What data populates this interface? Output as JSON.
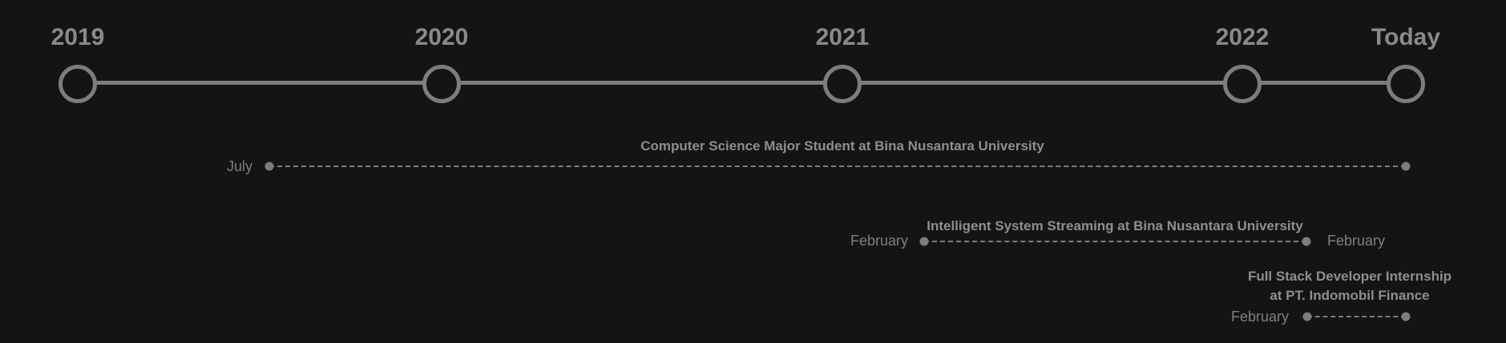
{
  "years": [
    "2019",
    "2020",
    "2021",
    "2022",
    "Today"
  ],
  "events": [
    {
      "title": "Computer Science Major Student at Bina Nusantara University",
      "start_label": "July",
      "end_label": ""
    },
    {
      "title": "Intelligent System Streaming at Bina Nusantara University",
      "start_label": "February",
      "end_label": "February"
    },
    {
      "title_line1": "Full Stack Developer Internship",
      "title_line2": "at PT. Indomobil Finance",
      "start_label": "February",
      "end_label": ""
    }
  ]
}
